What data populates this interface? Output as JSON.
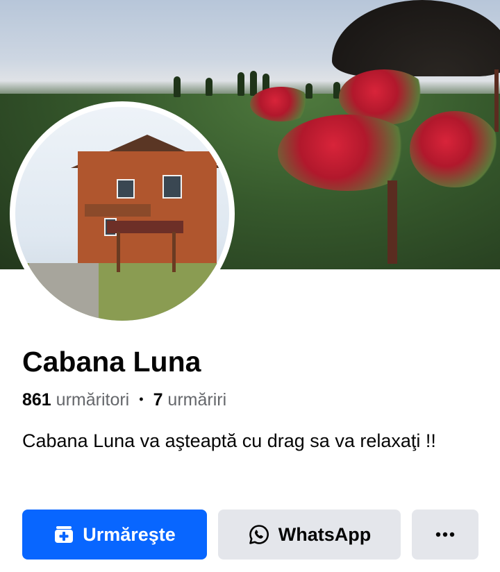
{
  "page": {
    "name": "Cabana Luna",
    "followers_count": "861",
    "followers_label": "urmăritori",
    "separator": "•",
    "following_count": "7",
    "following_label": "urmăriri",
    "bio": "Cabana Luna va aşteaptă cu drag sa va relaxaţi !!"
  },
  "actions": {
    "follow_label": "Urmăreşte",
    "whatsapp_label": "WhatsApp",
    "more_label": "•••"
  },
  "icons": {
    "follow": "follow-page-icon",
    "whatsapp": "whatsapp-icon",
    "more": "more-options-icon"
  },
  "colors": {
    "primary_button": "#0866ff",
    "secondary_button": "#e4e6eb",
    "text_primary": "#050505",
    "text_secondary": "#65676b"
  }
}
